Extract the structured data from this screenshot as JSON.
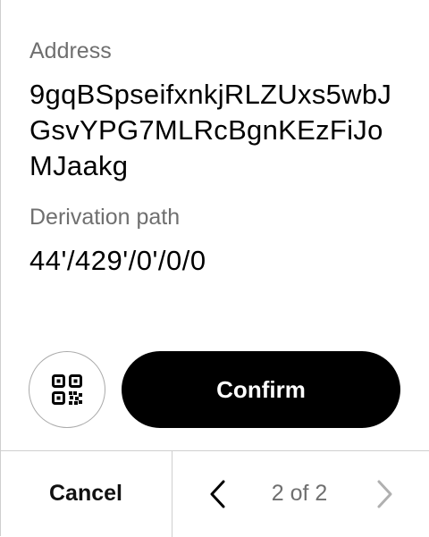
{
  "address": {
    "label": "Address",
    "value": "9gqBSpseifxnkjRLZUxs5wbJGsvYPG7MLRcBgnKEzFiJoMJaakg"
  },
  "derivation": {
    "label": "Derivation path",
    "value": "44'/429'/0'/0/0"
  },
  "actions": {
    "qr_icon": "qr-code-icon",
    "confirm_label": "Confirm"
  },
  "footer": {
    "cancel_label": "Cancel",
    "pager_text": "2 of 2",
    "prev_icon": "chevron-left-icon",
    "next_icon": "chevron-right-icon"
  },
  "colors": {
    "primary": "#000000",
    "muted_text": "#6f6f6f",
    "disabled": "#b0b0b0",
    "border": "#cfcfcf"
  }
}
